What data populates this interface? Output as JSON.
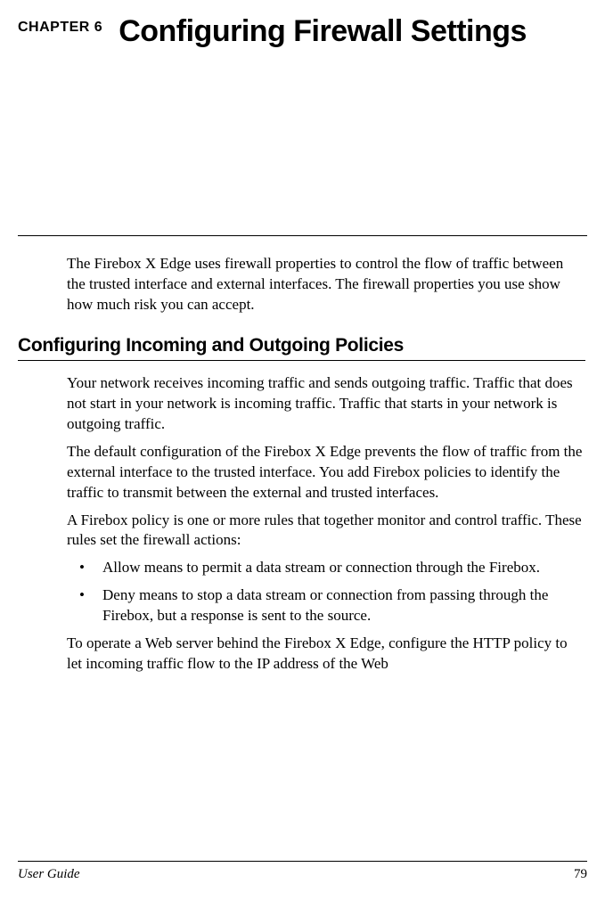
{
  "header": {
    "chapter_label": "CHAPTER 6",
    "chapter_title": "Configuring Firewall Settings"
  },
  "intro_paragraph": "The Firebox X Edge uses firewall properties to control the flow of traffic between the trusted interface and external interfaces. The firewall properties you use show how much risk you can accept.",
  "section": {
    "heading": "Configuring Incoming and Outgoing Policies",
    "paragraphs": [
      "Your network receives incoming traffic and sends outgoing traffic. Traffic that does not start in your network is incoming traffic. Traffic that starts in your network is outgoing traffic.",
      "The default configuration of the Firebox X Edge prevents the flow of traffic from the external interface to the trusted interface. You add Firebox policies to identify the traffic to transmit between the external and trusted interfaces.",
      "A Firebox policy is one or more rules that together monitor and control traffic. These rules set the firewall actions:"
    ],
    "bullets": [
      "Allow means to permit a data stream or connection through the Firebox.",
      "Deny means to stop a data stream or connection from passing through the Firebox, but a response is sent to the source."
    ],
    "after_bullets": "To operate a Web server behind the Firebox X Edge, configure the HTTP policy to let incoming traffic flow to the IP address of the Web"
  },
  "footer": {
    "left": "User Guide",
    "right": "79"
  }
}
